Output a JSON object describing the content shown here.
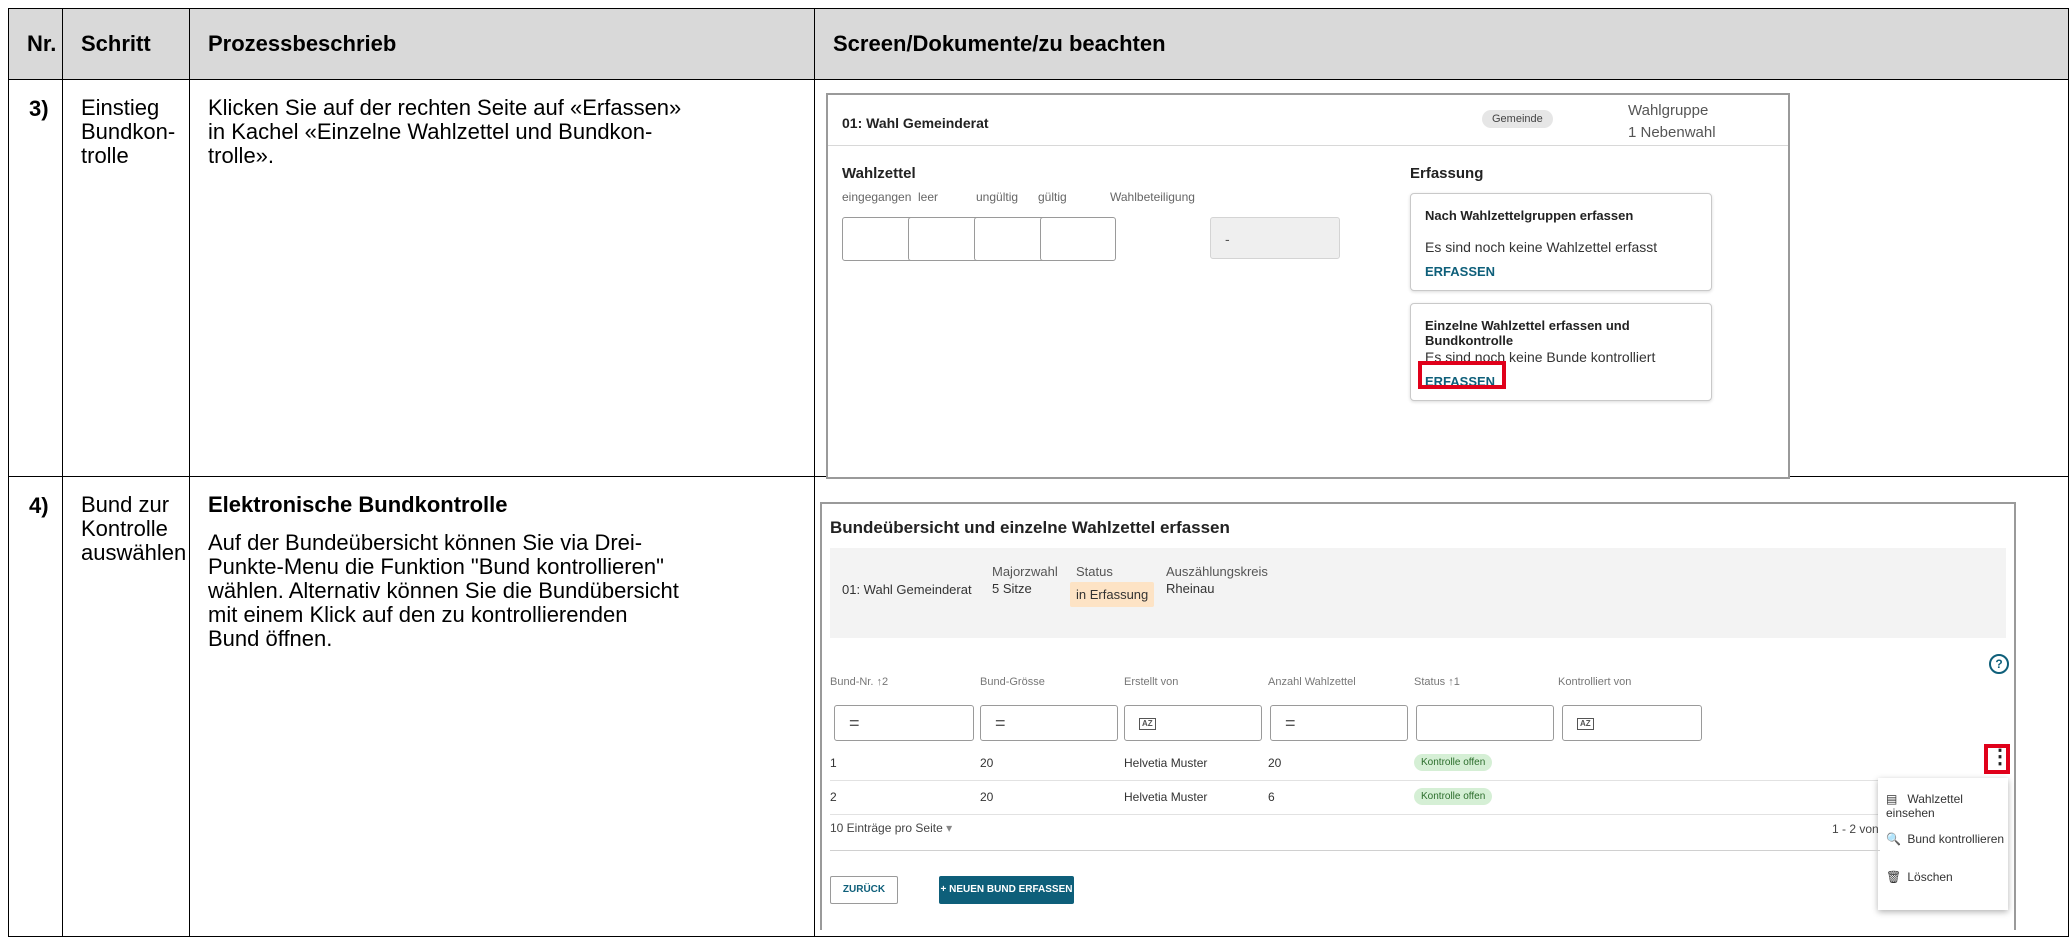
{
  "table": {
    "headers": [
      "Nr.",
      "Schritt",
      "Prozessbeschrieb",
      "Screen/Dokumente/zu beachten"
    ],
    "rows": [
      {
        "nr": "3)",
        "step_lines": [
          "Einstieg",
          "Bundkon-",
          "trolle"
        ],
        "desc_lines": [
          "Klicken Sie auf der rechten Seite auf «Erfassen»",
          "in Kachel «Einzelne Wahlzettel und Bundkon-",
          "trolle»."
        ]
      },
      {
        "nr": "4)",
        "step_lines": [
          "Bund zur",
          "Kontrolle",
          "auswählen"
        ],
        "desc_heading": "Elektronische Bundkontrolle",
        "desc_lines": [
          "Auf der Bundeübersicht können Sie via Drei-",
          "Punkte-Menu die Funktion \"Bund kontrollieren\"",
          "wählen. Alternativ können Sie die Bundübersicht",
          "mit einem Klick auf den zu kontrollierenden",
          "Bund öffnen."
        ]
      }
    ]
  },
  "shot1": {
    "title": "01: Wahl Gemeinderat",
    "chip": "Gemeinde",
    "wahlgruppe": "Wahlgruppe",
    "nebenwahl": "1 Nebenwahl",
    "wahlzettel": "Wahlzettel",
    "cols": [
      "eingegangen",
      "leer",
      "ungültig",
      "gültig",
      "Wahlbeteiligung"
    ],
    "beteiligung_value": "-",
    "erfassung": "Erfassung",
    "card1": {
      "title": "Nach Wahlzettelgruppen erfassen",
      "body": "Es sind noch keine Wahlzettel erfasst",
      "action": "ERFASSEN"
    },
    "card2": {
      "title": "Einzelne Wahlzettel erfassen und Bundkontrolle",
      "body": "Es sind noch keine Bunde kontrolliert",
      "action": "ERFASSEN"
    }
  },
  "shot2": {
    "title": "Bundeübersicht und einzelne Wahlzettel erfassen",
    "info": {
      "wahl": "01: Wahl Gemeinderat",
      "majorz_label": "Majorzwahl",
      "majorz_value": "5 Sitze",
      "status_label": "Status",
      "status_value": "in Erfassung",
      "kreis_label": "Auszählungskreis",
      "kreis_value": "Rheinau"
    },
    "help": "?",
    "columns": [
      "Bund-Nr. ↑2",
      "Bund-Grösse",
      "Erstellt von",
      "Anzahl Wahlzettel",
      "Status ↑1",
      "Kontrolliert von"
    ],
    "filter_eq": "=",
    "filter_az": "AZ",
    "rows": [
      {
        "nr": "1",
        "groesse": "20",
        "erstellt": "Helvetia Muster",
        "anzahl": "20",
        "status": "Kontrolle offen"
      },
      {
        "nr": "2",
        "groesse": "20",
        "erstellt": "Helvetia Muster",
        "anzahl": "6",
        "status": "Kontrolle offen"
      }
    ],
    "kebab": "⋮",
    "menu": [
      {
        "icon": "▤",
        "label": "Wahlzettel einsehen"
      },
      {
        "icon": "🔍",
        "label": "Bund kontrollieren"
      },
      {
        "icon": "🗑",
        "label": "Löschen"
      }
    ],
    "pager_text": "10 Einträge pro Seite",
    "pager_caret": "▾",
    "range_text": "1 - 2 von",
    "btn_back": "ZURÜCK",
    "btn_new": "+ NEUEN BUND ERFASSEN"
  }
}
